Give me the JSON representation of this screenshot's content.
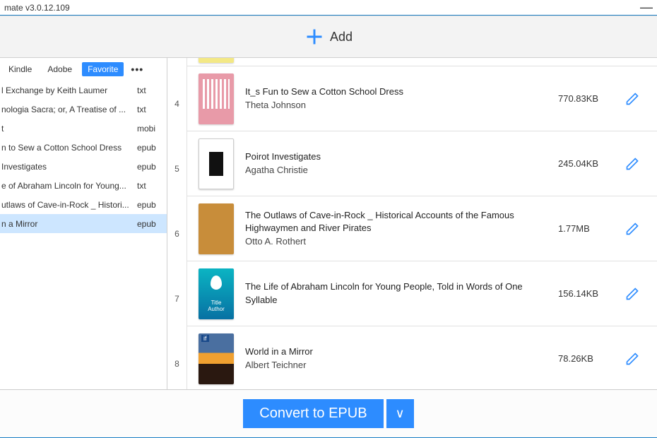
{
  "titlebar": {
    "title": "mate v3.0.12.109",
    "min": "—"
  },
  "toolbar": {
    "add": "Add"
  },
  "tabs": {
    "kindle": "Kindle",
    "adobe": "Adobe",
    "favorite": "Favorite",
    "more": "•••"
  },
  "sidebar": {
    "items": [
      {
        "title": "l Exchange by Keith Laumer",
        "fmt": "txt"
      },
      {
        "title": "nologia Sacra; or, A Treatise of ...",
        "fmt": "txt"
      },
      {
        "title": "t",
        "fmt": "mobi"
      },
      {
        "title": "n to Sew a Cotton School Dress",
        "fmt": "epub"
      },
      {
        "title": "Investigates",
        "fmt": "epub"
      },
      {
        "title": "e of Abraham Lincoln for Young...",
        "fmt": "txt"
      },
      {
        "title": "utlaws of Cave-in-Rock _ Histori...",
        "fmt": "epub"
      },
      {
        "title": "n a Mirror",
        "fmt": "epub",
        "selected": true
      }
    ]
  },
  "numbers": [
    "4",
    "5",
    "6",
    "7",
    "8"
  ],
  "books": [
    {
      "idx": 4,
      "title": "It_s Fun to Sew a Cotton School Dress",
      "author": "Theta Johnson",
      "size": "770.83KB",
      "cover": "c4"
    },
    {
      "idx": 5,
      "title": "Poirot Investigates",
      "author": "Agatha Christie",
      "size": "245.04KB",
      "cover": "c5"
    },
    {
      "idx": 6,
      "title": "The Outlaws of Cave-in-Rock _ Historical Accounts of the Famous Highwaymen and River Pirates",
      "author": "Otto A. Rothert",
      "size": "1.77MB",
      "cover": "c6"
    },
    {
      "idx": 7,
      "title": "The Life of Abraham Lincoln for Young People, Told in Words of One Syllable",
      "author": "",
      "size": "156.14KB",
      "cover": "c7"
    },
    {
      "idx": 8,
      "title": "World in a Mirror",
      "author": "Albert Teichner",
      "size": "78.26KB",
      "cover": "c8"
    }
  ],
  "bottom": {
    "convert": "Convert to EPUB",
    "drop": "∨"
  }
}
